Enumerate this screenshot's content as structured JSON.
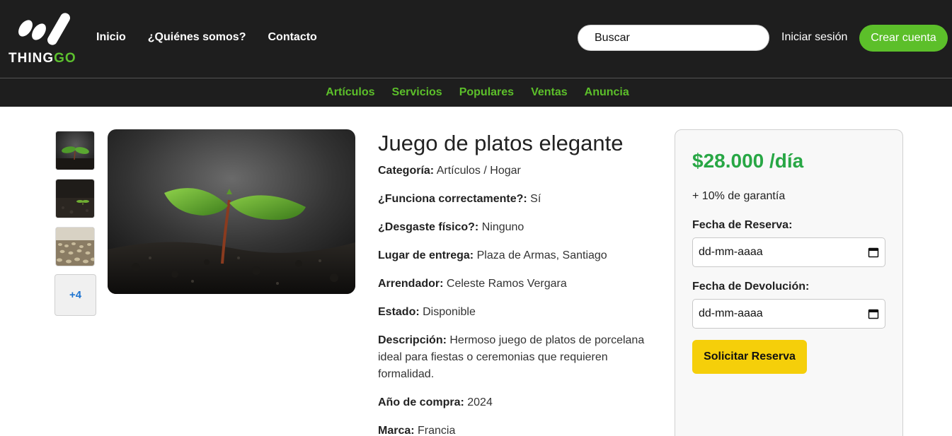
{
  "brand": {
    "name_prefix": "THING",
    "name_suffix": "GO",
    "accent": "#5cbf2a"
  },
  "main_nav": [
    {
      "label": "Inicio"
    },
    {
      "label": "¿Quiénes somos?"
    },
    {
      "label": "Contacto"
    }
  ],
  "search": {
    "placeholder": "Buscar"
  },
  "auth": {
    "login_label": "Iniciar sesión",
    "signup_label": "Crear cuenta"
  },
  "category_nav": [
    {
      "label": "Artículos"
    },
    {
      "label": "Servicios"
    },
    {
      "label": "Populares"
    },
    {
      "label": "Ventas"
    },
    {
      "label": "Anuncia"
    }
  ],
  "gallery": {
    "more_label": "+4",
    "thumbnail_icons": [
      "sprout-photo",
      "sprout-photo",
      "grains-photo"
    ],
    "main_image_icon": "sprout-photo"
  },
  "product": {
    "title": "Juego de platos elegante",
    "fields": [
      {
        "label": "Categoría:",
        "value": "Artículos / Hogar"
      },
      {
        "label": "¿Funciona correctamente?:",
        "value": "Sí"
      },
      {
        "label": "¿Desgaste físico?:",
        "value": "Ninguno"
      },
      {
        "label": "Lugar de entrega:",
        "value": "Plaza de Armas, Santiago"
      },
      {
        "label": "Arrendador:",
        "value": "Celeste Ramos Vergara"
      },
      {
        "label": "Estado:",
        "value": "Disponible"
      },
      {
        "label": "Descripción:",
        "value": "Hermoso juego de platos de porcelana ideal para fiestas o ceremonias que requieren formalidad."
      },
      {
        "label": "Año de compra:",
        "value": "2024"
      },
      {
        "label": "Marca:",
        "value": "Francia"
      }
    ]
  },
  "booking": {
    "price": "$28.000 /día",
    "deposit": "+ 10% de garantía",
    "start_label": "Fecha de Reserva:",
    "start_value": "dd-mm-aaaa",
    "end_label": "Fecha de Devolución:",
    "end_value": "dd-mm-aaaa",
    "submit_label": "Solicitar Reserva",
    "price_color": "#28a745",
    "submit_color": "#f5cf0a"
  }
}
